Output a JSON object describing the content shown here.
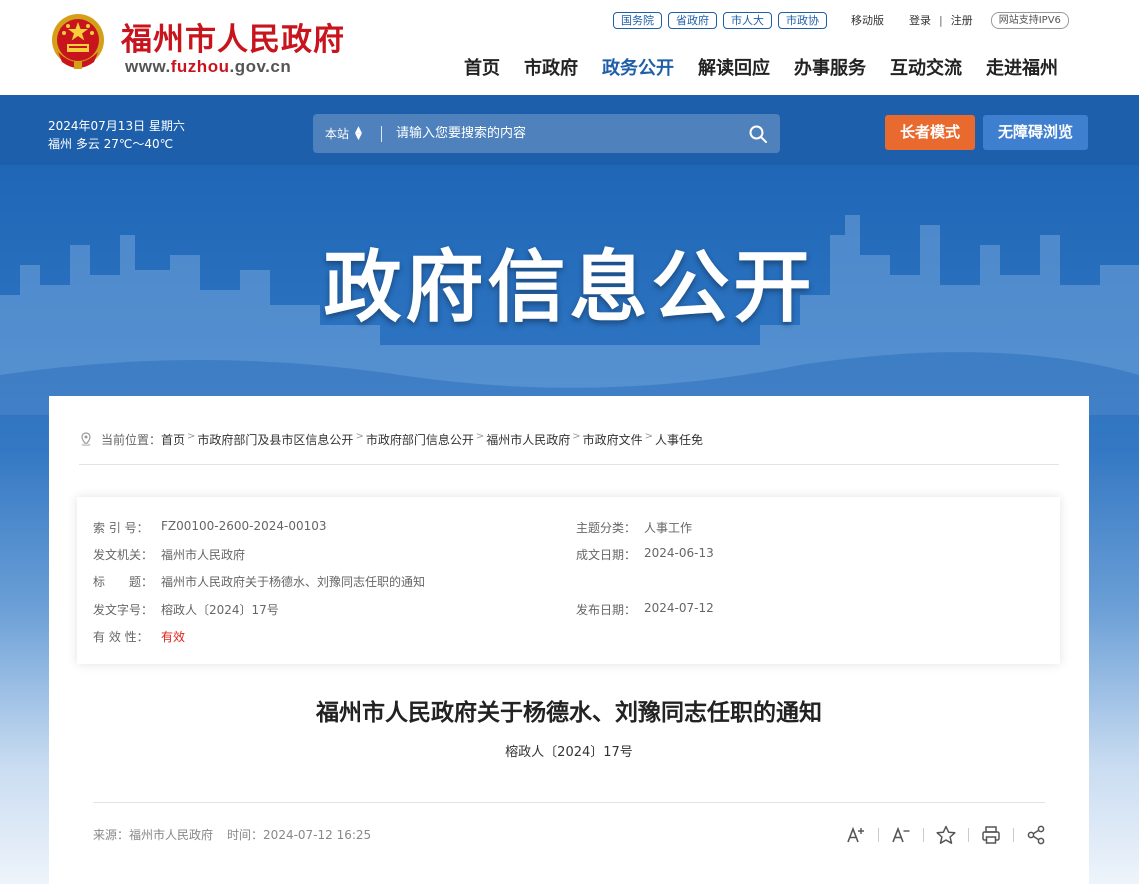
{
  "header": {
    "site_title": "福州市人民政府",
    "domain_prefix": "www.",
    "domain_highlight": "fuzhou",
    "domain_suffix": ".gov.cn",
    "top_pills": [
      "国务院",
      "省政府",
      "市人大",
      "市政协"
    ],
    "mobile": "移动版",
    "login": "登录",
    "divider": "|",
    "register": "注册",
    "ipv6": "网站支持IPV6",
    "nav": [
      "首页",
      "市政府",
      "政务公开",
      "解读回应",
      "办事服务",
      "互动交流",
      "走进福州"
    ],
    "active_nav": "政务公开"
  },
  "toolbar": {
    "date": "2024年07月13日 星期六",
    "weather": "福州 多云 27℃～40℃",
    "search_scope": "本站",
    "search_placeholder": "请输入您要搜索的内容",
    "elder_mode": "长者模式",
    "accessible": "无障碍浏览"
  },
  "hero": {
    "title": "政府信息公开"
  },
  "breadcrumb": {
    "label": "当前位置：",
    "items": [
      "首页",
      "市政府部门及县市区信息公开",
      "市政府部门信息公开",
      "福州市人民政府",
      "市政府文件",
      "人事任免"
    ]
  },
  "meta": {
    "index_no_label": "索 引 号：",
    "index_no": "FZ00100-2600-2024-00103",
    "topic_label": "主题分类：",
    "topic": "人事工作",
    "issuer_label": "发文机关：",
    "issuer": "福州市人民政府",
    "written_label": "成文日期：",
    "written": "2024-06-13",
    "title_label": "标　　题：",
    "title": "福州市人民政府关于杨德水、刘豫同志任职的通知",
    "doc_no_label": "发文字号：",
    "doc_no": "榕政人〔2024〕17号",
    "published_label": "发布日期：",
    "published": "2024-07-12",
    "validity_label": "有 效 性：",
    "validity": "有效"
  },
  "document": {
    "title": "福州市人民政府关于杨德水、刘豫同志任职的通知",
    "doc_no": "榕政人〔2024〕17号",
    "source_label": "来源：",
    "source": "福州市人民政府",
    "time_label": "时间：",
    "time": "2024-07-12 16:25"
  },
  "colors": {
    "brand_red": "#c8151d",
    "brand_blue": "#1f5fa8",
    "elder_orange": "#e96a2f",
    "accessible_blue": "#3e7fcf",
    "valid_red": "#e0231b"
  }
}
